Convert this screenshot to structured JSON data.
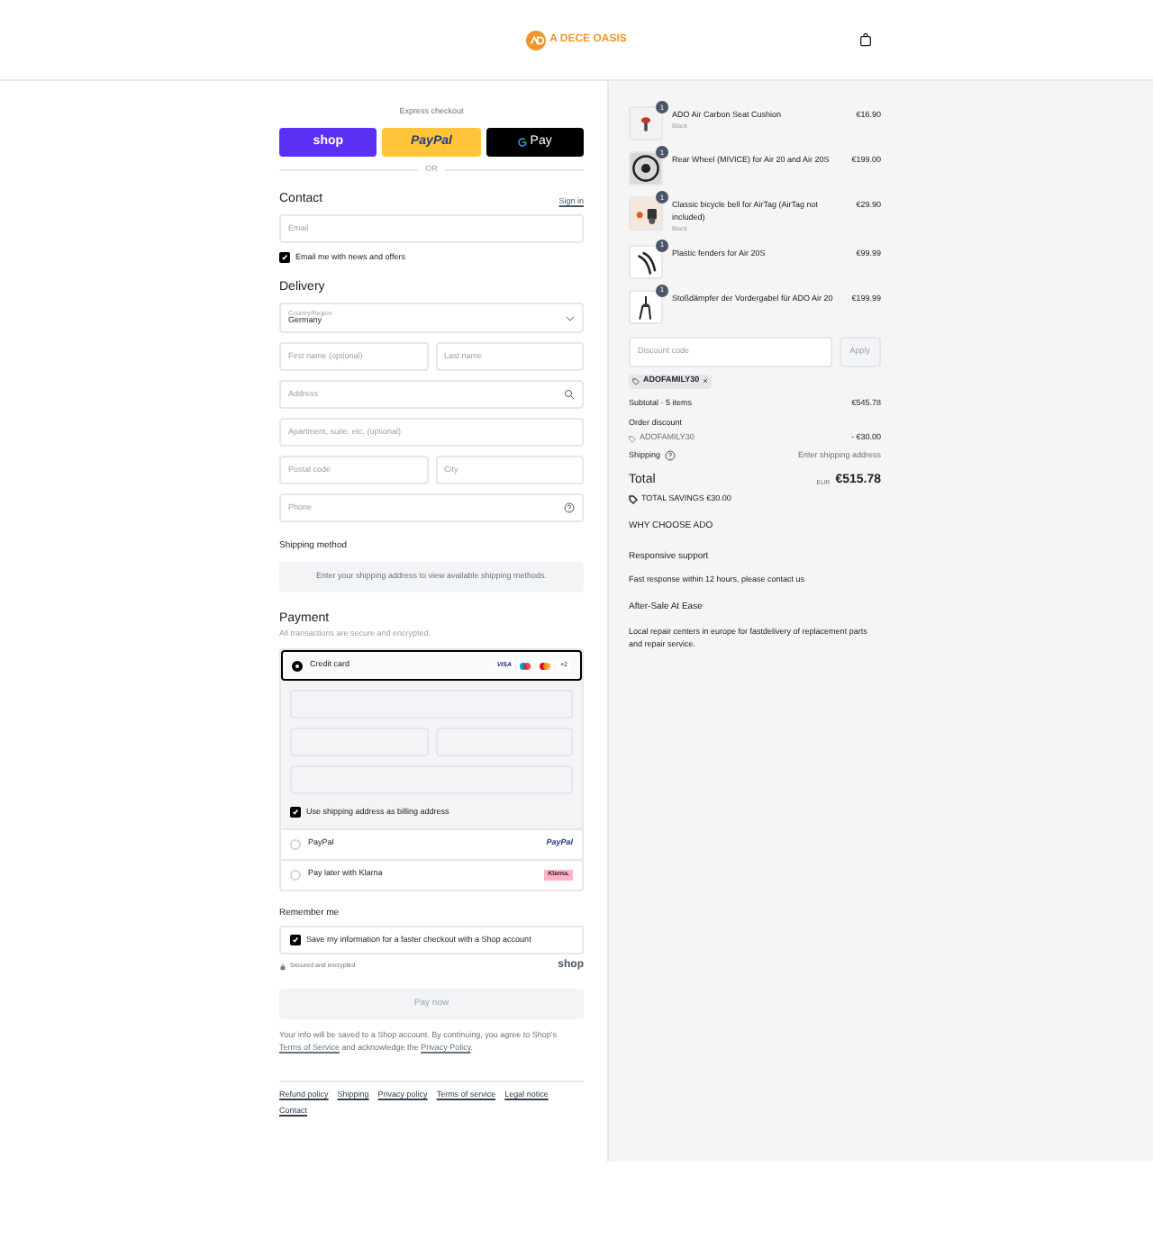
{
  "header": {
    "brand": "A DECE OASIS"
  },
  "express": {
    "title": "Express checkout",
    "buttons": [
      {
        "kind": "shop",
        "label": "shop"
      },
      {
        "kind": "paypal",
        "label": "PayPal"
      },
      {
        "kind": "gpay",
        "label": "Pay"
      }
    ],
    "divider": "OR"
  },
  "contact": {
    "title": "Contact",
    "sign_in": "Sign in",
    "email": {
      "placeholder": "Email"
    },
    "newsletter": {
      "label": "Email me with news and offers",
      "checked": true
    }
  },
  "delivery": {
    "title": "Delivery",
    "country": {
      "label": "Country/Region",
      "value": "Germany"
    },
    "rows": [
      [
        {
          "placeholder": "First name (optional)"
        },
        {
          "placeholder": "Last name"
        }
      ],
      [
        {
          "placeholder": "Address",
          "kind": "search"
        }
      ],
      [
        {
          "placeholder": "Apartment, suite, etc. (optional)"
        }
      ],
      [
        {
          "placeholder": "Postal code"
        },
        {
          "placeholder": "City"
        }
      ],
      [
        {
          "placeholder": "Phone",
          "kind": "help"
        }
      ]
    ]
  },
  "shipping_method": {
    "title": "Shipping method",
    "message": "Enter your shipping address to view available shipping methods."
  },
  "payment": {
    "title": "Payment",
    "subtitle": "All transactions are secure and encrypted.",
    "methods": [
      {
        "kind": "card",
        "label": "Credit card",
        "selected": true,
        "visa": "VISA",
        "more": "+2"
      },
      {
        "kind": "paypal",
        "label": "PayPal",
        "selected": false,
        "logo": "PayPal"
      },
      {
        "kind": "klarna",
        "label": "Pay later with Klarna",
        "selected": false,
        "logo": "Klarna."
      }
    ],
    "billing_same": {
      "label": "Use shipping address as billing address",
      "checked": true
    }
  },
  "remember": {
    "title": "Remember me",
    "save": {
      "label": "Save my information for a faster checkout with a Shop account",
      "checked": true
    },
    "secure": "Secured and encrypted",
    "shop_logo": "shop"
  },
  "pay_button": {
    "label": "Pay now",
    "disabled": true
  },
  "legal": [
    {
      "text": "Your info will be saved to a Shop account. By continuing, you agree to Shop's "
    },
    {
      "link": "Terms of Service"
    },
    {
      "text": " and acknowledge the "
    },
    {
      "link": "Privacy Policy"
    },
    {
      "text": "."
    }
  ],
  "footer_links": [
    "Refund policy",
    "Shipping",
    "Privacy policy",
    "Terms of service",
    "Legal notice",
    "Contact"
  ],
  "items": [
    {
      "name": "ADO Air Carbon Seat Cushion",
      "variant": "Black",
      "price": "€16.90",
      "quantity": "1"
    },
    {
      "name": "Rear Wheel (MIVICE) for Air 20 and Air 20S",
      "price": "€199.00",
      "quantity": "1"
    },
    {
      "name": "Classic bicycle bell for AirTag (AirTag not included)",
      "variant": "Black",
      "price": "€29.90",
      "quantity": "1"
    },
    {
      "name": "Plastic fenders for Air 20S",
      "price": "€99.99",
      "quantity": "1"
    },
    {
      "name": "Stoßdämpfer der Vordergabel für ADO Air 20",
      "price": "€199.99",
      "quantity": "1"
    }
  ],
  "discount": {
    "placeholder": "Discount code",
    "apply": "Apply",
    "applied_code": "ADOFAMILY30"
  },
  "summary": {
    "subtotal_label": "Subtotal · 5 items",
    "subtotal": "€545.78",
    "order_discount": "Order discount",
    "discount_code": "ADOFAMILY30",
    "discount_value": "- €30.00",
    "shipping_label": "Shipping",
    "shipping_value": "Enter shipping address",
    "total_label": "Total",
    "currency": "EUR",
    "total": "€515.78",
    "savings": "TOTAL SAVINGS €30.00"
  },
  "why": {
    "title": "WHY CHOOSE ADO",
    "blocks": [
      {
        "heading": "Responsive support",
        "text": "Fast response within 12 hours, please contact us"
      },
      {
        "heading": "After-Sale At Ease",
        "text": "Local repair centers in europe for fastdelivery of replacement parts and repair service."
      }
    ]
  }
}
